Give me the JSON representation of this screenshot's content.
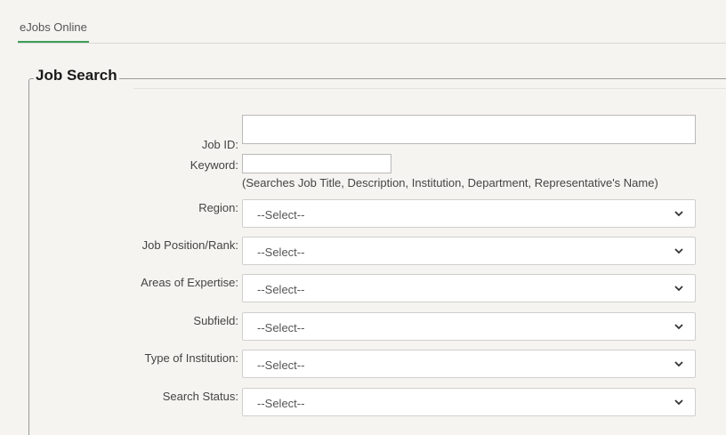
{
  "tab": {
    "label": "eJobs Online"
  },
  "legend": "Job Search",
  "fields": {
    "job_id": {
      "label": "Job ID:",
      "value": ""
    },
    "keyword": {
      "label": "Keyword:",
      "value": "",
      "hint": "(Searches Job Title, Description, Institution, Department, Representative's Name)"
    },
    "region": {
      "label": "Region:",
      "selected": "--Select--"
    },
    "job_position": {
      "label": "Job Position/Rank:",
      "selected": "--Select--"
    },
    "areas_of_expertise": {
      "label": "Areas of Expertise:",
      "selected": "--Select--"
    },
    "subfield": {
      "label": "Subfield:",
      "selected": "--Select--"
    },
    "type_of_institution": {
      "label": "Type of Institution:",
      "selected": "--Select--"
    },
    "search_status": {
      "label": "Search Status:",
      "selected": "--Select--"
    }
  },
  "colors": {
    "tab_underline": "#3f9d5a",
    "background": "#f5f4f0"
  },
  "icons": {
    "select_arrow": "chevron-down-icon"
  }
}
